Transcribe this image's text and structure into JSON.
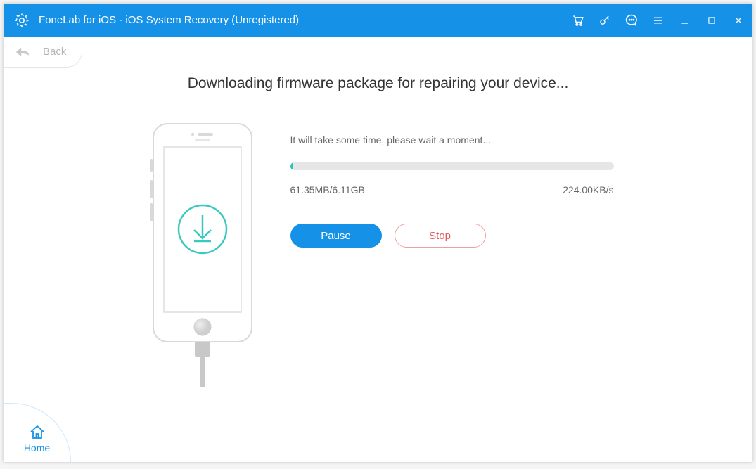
{
  "titlebar": {
    "title": "FoneLab for iOS - iOS System Recovery (Unregistered)"
  },
  "nav": {
    "back": "Back",
    "home": "Home"
  },
  "main": {
    "headline": "Downloading firmware package for repairing your device...",
    "wait_text": "It will take some time, please wait a moment...",
    "progress_pct_text": "0.98%",
    "progress_pct_value": 0.98,
    "downloaded": "61.35MB/6.11GB",
    "speed": "224.00KB/s",
    "pause_label": "Pause",
    "stop_label": "Stop"
  },
  "colors": {
    "accent": "#1591e7",
    "teal": "#27c4b8",
    "danger": "#e05a5a"
  }
}
